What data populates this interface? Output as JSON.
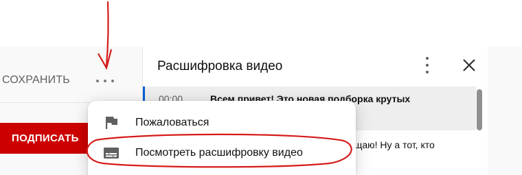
{
  "toolbar": {
    "save_label": "СОХРАНИТЬ",
    "more_icon": "more-horizontal-icon"
  },
  "channel": {
    "subscribe_label": "ПОДПИСАТЬ"
  },
  "transcript": {
    "title": "Расшифровка видео",
    "more_icon": "more-vertical-icon",
    "close_icon": "close-icon",
    "rows": [
      {
        "time": "00:00",
        "text": "Всем привет! Это новая подборка крутых"
      },
      {
        "time": "",
        "text": "ищаю! Ну а тот, кто"
      }
    ]
  },
  "menu": {
    "items": [
      {
        "label": "Пожаловаться",
        "icon": "flag-icon"
      },
      {
        "label": "Посмотреть расшифровку видео",
        "icon": "subtitles-icon"
      }
    ]
  },
  "colors": {
    "accent_blue": "#065fd4",
    "subscribe_red": "#cc0000",
    "annotation_red": "#d61a1a"
  }
}
